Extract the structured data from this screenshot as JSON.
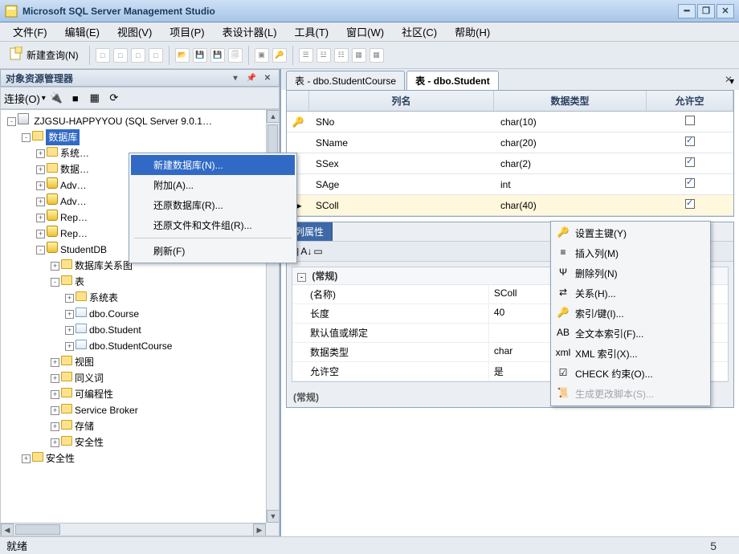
{
  "title": "Microsoft SQL Server Management Studio",
  "menubar": [
    "文件(F)",
    "编辑(E)",
    "视图(V)",
    "项目(P)",
    "表设计器(L)",
    "工具(T)",
    "窗口(W)",
    "社区(C)",
    "帮助(H)"
  ],
  "toolbar": {
    "new_query": "新建查询(N)"
  },
  "object_explorer": {
    "title": "对象资源管理器",
    "connect_label": "连接(O)",
    "server": "ZJGSU-HAPPYYOU (SQL Server 9.0.1…",
    "db_root": "数据库",
    "nodes": {
      "sysdb": "系统…",
      "dbsnap": "数据…",
      "adv1": "Adv…",
      "adv2": "Adv…",
      "rep1": "Rep…",
      "rep2": "Rep…",
      "studentdb": "StudentDB",
      "diagrams": "数据库关系图",
      "tables": "表",
      "systables": "系统表",
      "t_course": "dbo.Course",
      "t_student": "dbo.Student",
      "t_studentcourse": "dbo.StudentCourse",
      "views": "视图",
      "synonyms": "同义词",
      "programmability": "可编程性",
      "servicebroker": "Service Broker",
      "storage": "存储",
      "security_db": "安全性",
      "security_srv": "安全性"
    }
  },
  "db_context_menu": {
    "items": [
      {
        "label": "新建数据库(N)...",
        "hl": true
      },
      {
        "label": "附加(A)..."
      },
      {
        "label": "还原数据库(R)..."
      },
      {
        "label": "还原文件和文件组(R)..."
      },
      {
        "sep": true
      },
      {
        "label": "刷新(F)"
      }
    ]
  },
  "tabs": {
    "inactive": "表 - dbo.StudentCourse",
    "active": "表 - dbo.Student"
  },
  "grid": {
    "headers": {
      "col_name": "列名",
      "data_type": "数据类型",
      "allow_null": "允许空"
    },
    "rows": [
      {
        "pk": true,
        "sel": false,
        "name": "SNo",
        "type": "char(10)",
        "null": false
      },
      {
        "pk": false,
        "sel": false,
        "name": "SName",
        "type": "char(20)",
        "null": true
      },
      {
        "pk": false,
        "sel": false,
        "name": "SSex",
        "type": "char(2)",
        "null": true
      },
      {
        "pk": false,
        "sel": false,
        "name": "SAge",
        "type": "int",
        "null": true
      },
      {
        "pk": false,
        "sel": true,
        "name": "SColl",
        "type": "char(40)",
        "null": true
      }
    ]
  },
  "column_props": {
    "panel_title": "列属性",
    "category": "(常规)",
    "rows": [
      {
        "name": "(名称)",
        "value": "SColl"
      },
      {
        "name": "长度",
        "value": "40"
      },
      {
        "name": "默认值或绑定",
        "value": ""
      },
      {
        "name": "数据类型",
        "value": "char"
      },
      {
        "name": "允许空",
        "value": "是"
      }
    ],
    "footer": "(常规)"
  },
  "row_context_menu": {
    "items": [
      {
        "icon": "key",
        "label": "设置主键(Y)"
      },
      {
        "icon": "insert",
        "label": "插入列(M)"
      },
      {
        "icon": "delete",
        "label": "删除列(N)"
      },
      {
        "icon": "rel",
        "label": "关系(H)..."
      },
      {
        "icon": "idx",
        "label": "索引/键(I)..."
      },
      {
        "icon": "ft",
        "label": "全文本索引(F)..."
      },
      {
        "icon": "xml",
        "label": "XML 索引(X)..."
      },
      {
        "icon": "chk",
        "label": "CHECK 约束(O)..."
      },
      {
        "icon": "scr",
        "label": "生成更改脚本(S)...",
        "disabled": true
      }
    ]
  },
  "status": {
    "text": "就绪",
    "page": "5"
  }
}
